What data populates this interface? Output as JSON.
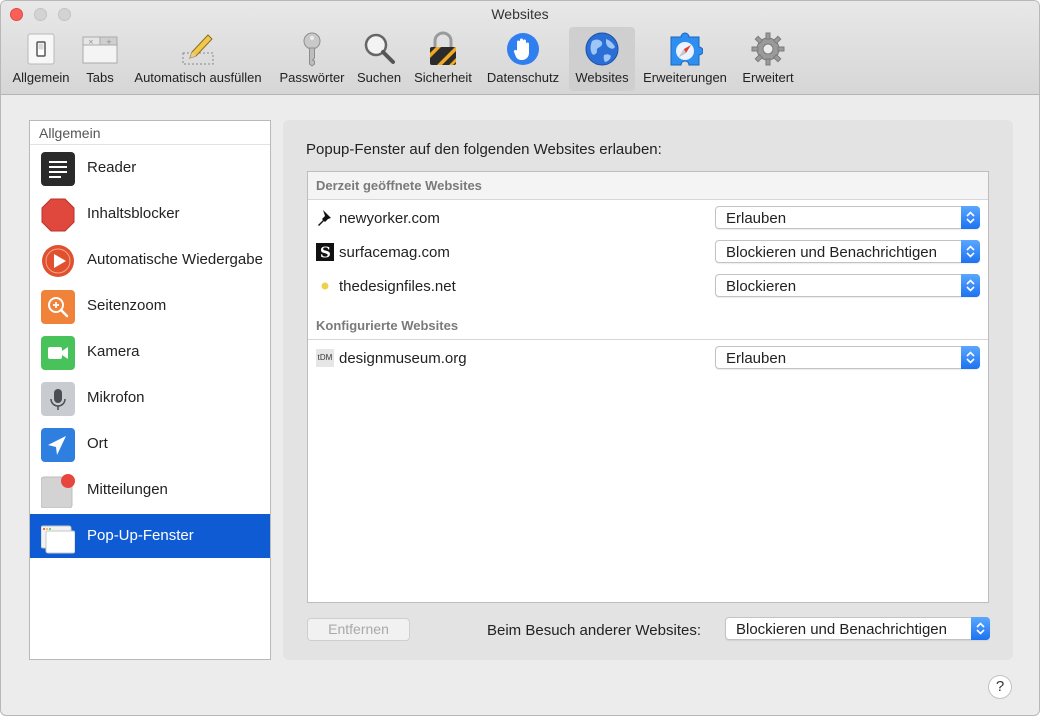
{
  "window": {
    "title": "Websites"
  },
  "toolbar": {
    "items": [
      {
        "label": "Allgemein",
        "icon": "general-switch-icon"
      },
      {
        "label": "Tabs",
        "icon": "tabs-icon"
      },
      {
        "label": "Automatisch ausfüllen",
        "icon": "pencil-icon"
      },
      {
        "label": "Passwörter",
        "icon": "key-icon"
      },
      {
        "label": "Suchen",
        "icon": "magnifier-icon"
      },
      {
        "label": "Sicherheit",
        "icon": "lock-icon"
      },
      {
        "label": "Datenschutz",
        "icon": "hand-icon"
      },
      {
        "label": "Websites",
        "icon": "globe-icon",
        "selected": true
      },
      {
        "label": "Erweiterungen",
        "icon": "puzzle-compass-icon"
      },
      {
        "label": "Erweitert",
        "icon": "gear-icon"
      }
    ]
  },
  "sidebar": {
    "header": "Allgemein",
    "items": [
      {
        "label": "Reader",
        "icon": "reader-icon"
      },
      {
        "label": "Inhaltsblocker",
        "icon": "stop-sign-icon"
      },
      {
        "label": "Automatische Wiedergabe",
        "icon": "play-icon"
      },
      {
        "label": "Seitenzoom",
        "icon": "zoom-icon"
      },
      {
        "label": "Kamera",
        "icon": "camera-icon"
      },
      {
        "label": "Mikrofon",
        "icon": "microphone-icon"
      },
      {
        "label": "Ort",
        "icon": "location-arrow-icon"
      },
      {
        "label": "Mitteilungen",
        "icon": "notifications-icon"
      },
      {
        "label": "Pop-Up-Fenster",
        "icon": "popup-window-icon",
        "active": true
      }
    ]
  },
  "main": {
    "title": "Popup-Fenster auf den folgenden Websites erlauben:",
    "section_open": "Derzeit geöffnete Websites",
    "section_configured": "Konfigurierte Websites",
    "open_sites": [
      {
        "name": "newyorker.com",
        "icon": "pushpin-icon",
        "setting": "Erlauben"
      },
      {
        "name": "surfacemag.com",
        "icon": "s-logo-icon",
        "setting": "Blockieren und Benachrichtigen"
      },
      {
        "name": "thedesignfiles.net",
        "icon": "yellow-dot-icon",
        "setting": "Blockieren"
      }
    ],
    "configured_sites": [
      {
        "name": "designmuseum.org",
        "icon": "dm-logo-icon",
        "icon_text": "tDM",
        "setting": "Erlauben"
      }
    ],
    "remove_label": "Entfernen",
    "other_label": "Beim Besuch anderer Websites:",
    "other_setting": "Blockieren und Benachrichtigen"
  },
  "help": {
    "label": "?"
  }
}
